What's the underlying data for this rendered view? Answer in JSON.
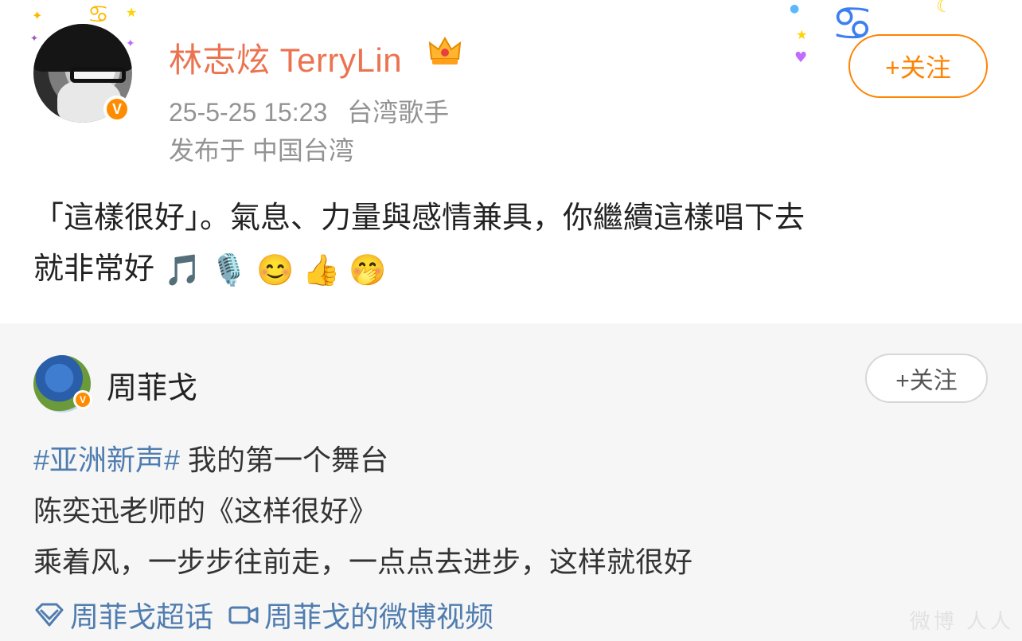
{
  "post": {
    "author": "林志炫 TerryLin",
    "date": "25-5-25 15:23",
    "tag": "台湾歌手",
    "location": "发布于 中国台湾",
    "follow_label": "+关注",
    "text_lines": [
      "「這樣很好」。氣息、力量與感情兼具，你繼續這樣唱下去",
      "就非常好"
    ],
    "emojis": [
      "🎵",
      "🎙️",
      "😊",
      "👍",
      "🤭"
    ],
    "verified_badge": "V"
  },
  "repost": {
    "author": "周菲戈",
    "follow_label": "+关注",
    "topic": "#亚洲新声#",
    "line1_rest": " 我的第一个舞台",
    "line2": "陈奕迅老师的《这样很好》",
    "line3": "乘着风，一步步往前走，一点点去进步，这样就很好",
    "links": [
      "周菲戈超话",
      "周菲戈的微博视频"
    ],
    "verified_badge": "V"
  },
  "watermark": "微博 人人",
  "colors": {
    "author": "#eb7350",
    "meta": "#939393",
    "follow": "#ff8200",
    "link": "#507daf",
    "card_bg": "#f6f6f6"
  },
  "icons": [
    "crown-icon",
    "verified-icon",
    "topic-diamond-icon",
    "video-camera-icon"
  ]
}
